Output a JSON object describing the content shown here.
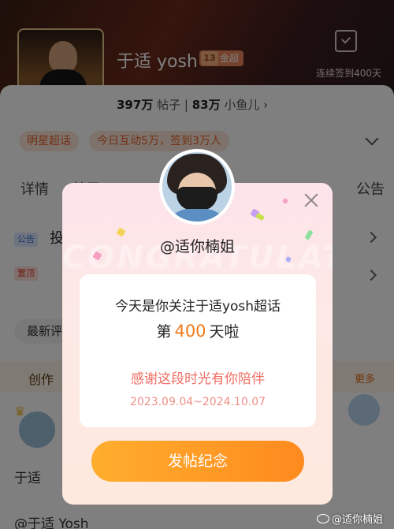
{
  "topic": {
    "name": "于适 yosh",
    "level_num": "13",
    "level_label": "金超",
    "signin_text": "连续签到400天",
    "posts_count": "397万",
    "posts_label": "帖子",
    "fans_count": "83万",
    "fans_label": "小鱼儿"
  },
  "tags": [
    "明星超话",
    "今日互动5万，签到3万人"
  ],
  "tabs": [
    "详情",
    "帖子"
  ],
  "tab_right": "公告",
  "notices": [
    {
      "badge": "公告",
      "text": "投"
    },
    {
      "badge": "置顶",
      "text": ""
    }
  ],
  "latest_label": "最新评",
  "creator_label": "创作",
  "more_label": "更多",
  "post_name": "于适",
  "bottom_name": "@于适 Yosh",
  "modal": {
    "bg_word": "CONGRATULATE",
    "username": "@适你楠姐",
    "line1": "今天是你关注于适yosh超话",
    "line2_prefix": "第",
    "days": "400",
    "line2_suffix": "天啦",
    "thanks": "感谢这段时光有你陪伴",
    "date_range": "2023.09.04~2024.10.07",
    "button_label": "发帖纪念"
  },
  "watermark": "@适你楠姐",
  "colors": {
    "accent": "#ff8a1e",
    "number": "#f07a1a",
    "thanks": "#ef6e63"
  }
}
